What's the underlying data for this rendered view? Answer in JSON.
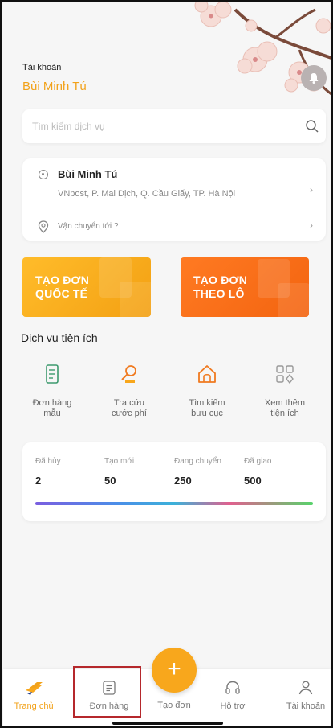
{
  "header": {
    "account_label": "Tài khoản",
    "account_name": "Bùi Minh Tú"
  },
  "search": {
    "placeholder": "Tìm kiếm dịch vụ"
  },
  "address": {
    "sender_name": "Bùi Minh Tú",
    "sender_address": "VNpost, P. Mai Dịch, Q. Cầu Giấy, TP. Hà Nội",
    "destination_placeholder": "Vận chuyển tới ?"
  },
  "actions": {
    "international": "TẠO ĐƠN\nQUỐC TẾ",
    "batch": "TẠO ĐƠN\nTHEO LÔ"
  },
  "services": {
    "title": "Dịch vụ tiện ích",
    "items": [
      {
        "label": "Đơn hàng\nmẫu",
        "icon": "document-template-icon"
      },
      {
        "label": "Tra cứu\ncước phí",
        "icon": "fee-lookup-icon"
      },
      {
        "label": "Tìm kiếm\nbưu cục",
        "icon": "post-office-icon"
      },
      {
        "label": "Xem thêm\ntiện ích",
        "icon": "more-apps-icon"
      }
    ]
  },
  "stats": [
    {
      "label": "Đã hủy",
      "value": "2"
    },
    {
      "label": "Tạo mới",
      "value": "50"
    },
    {
      "label": "Đang chuyển",
      "value": "250"
    },
    {
      "label": "Đã giao",
      "value": "500"
    }
  ],
  "nav": {
    "home": "Trang chủ",
    "orders": "Đơn hàng",
    "create": "Tạo đơn",
    "support": "Hỗ trợ",
    "account": "Tài khoản"
  },
  "colors": {
    "accent": "#f2a21a",
    "orange": "#f36410",
    "highlight": "#b5282c"
  }
}
